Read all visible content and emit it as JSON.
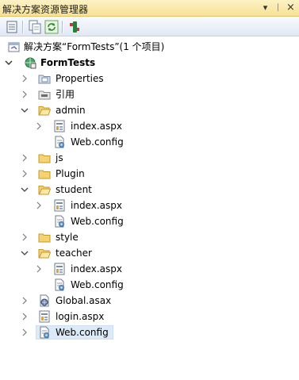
{
  "panel": {
    "title": "解决方案资源管理器",
    "pin_glyph": "▾",
    "dock_glyph": "ᛁ",
    "close_glyph": "×"
  },
  "toolbar": {
    "items": [
      "properties-icon",
      "show-all-files-icon",
      "refresh-icon",
      "view-code-icon"
    ]
  },
  "tree": {
    "solution": "解决方案“FormTests”(1 个项目)",
    "project": "FormTests",
    "items": [
      {
        "label": "Properties",
        "icon": "properties-folder-icon"
      },
      {
        "label": "引用",
        "icon": "references-icon"
      },
      {
        "label": "admin",
        "icon": "folder-open-icon"
      },
      {
        "label": "index.aspx",
        "icon": "aspx-file-icon"
      },
      {
        "label": "Web.config",
        "icon": "config-file-icon"
      },
      {
        "label": "js",
        "icon": "folder-icon"
      },
      {
        "label": "Plugin",
        "icon": "folder-icon"
      },
      {
        "label": "student",
        "icon": "folder-open-icon"
      },
      {
        "label": "index.aspx",
        "icon": "aspx-file-icon"
      },
      {
        "label": "Web.config",
        "icon": "config-file-icon"
      },
      {
        "label": "style",
        "icon": "folder-icon"
      },
      {
        "label": "teacher",
        "icon": "folder-open-icon"
      },
      {
        "label": "index.aspx",
        "icon": "aspx-file-icon"
      },
      {
        "label": "Web.config",
        "icon": "config-file-icon"
      },
      {
        "label": "Global.asax",
        "icon": "asax-file-icon"
      },
      {
        "label": "login.aspx",
        "icon": "aspx-file-icon"
      },
      {
        "label": "Web.config",
        "icon": "config-file-icon"
      }
    ]
  },
  "colors": {
    "selection": "#dceaf8",
    "folder": "#e8c15a",
    "title_bar": "#f7e196"
  }
}
